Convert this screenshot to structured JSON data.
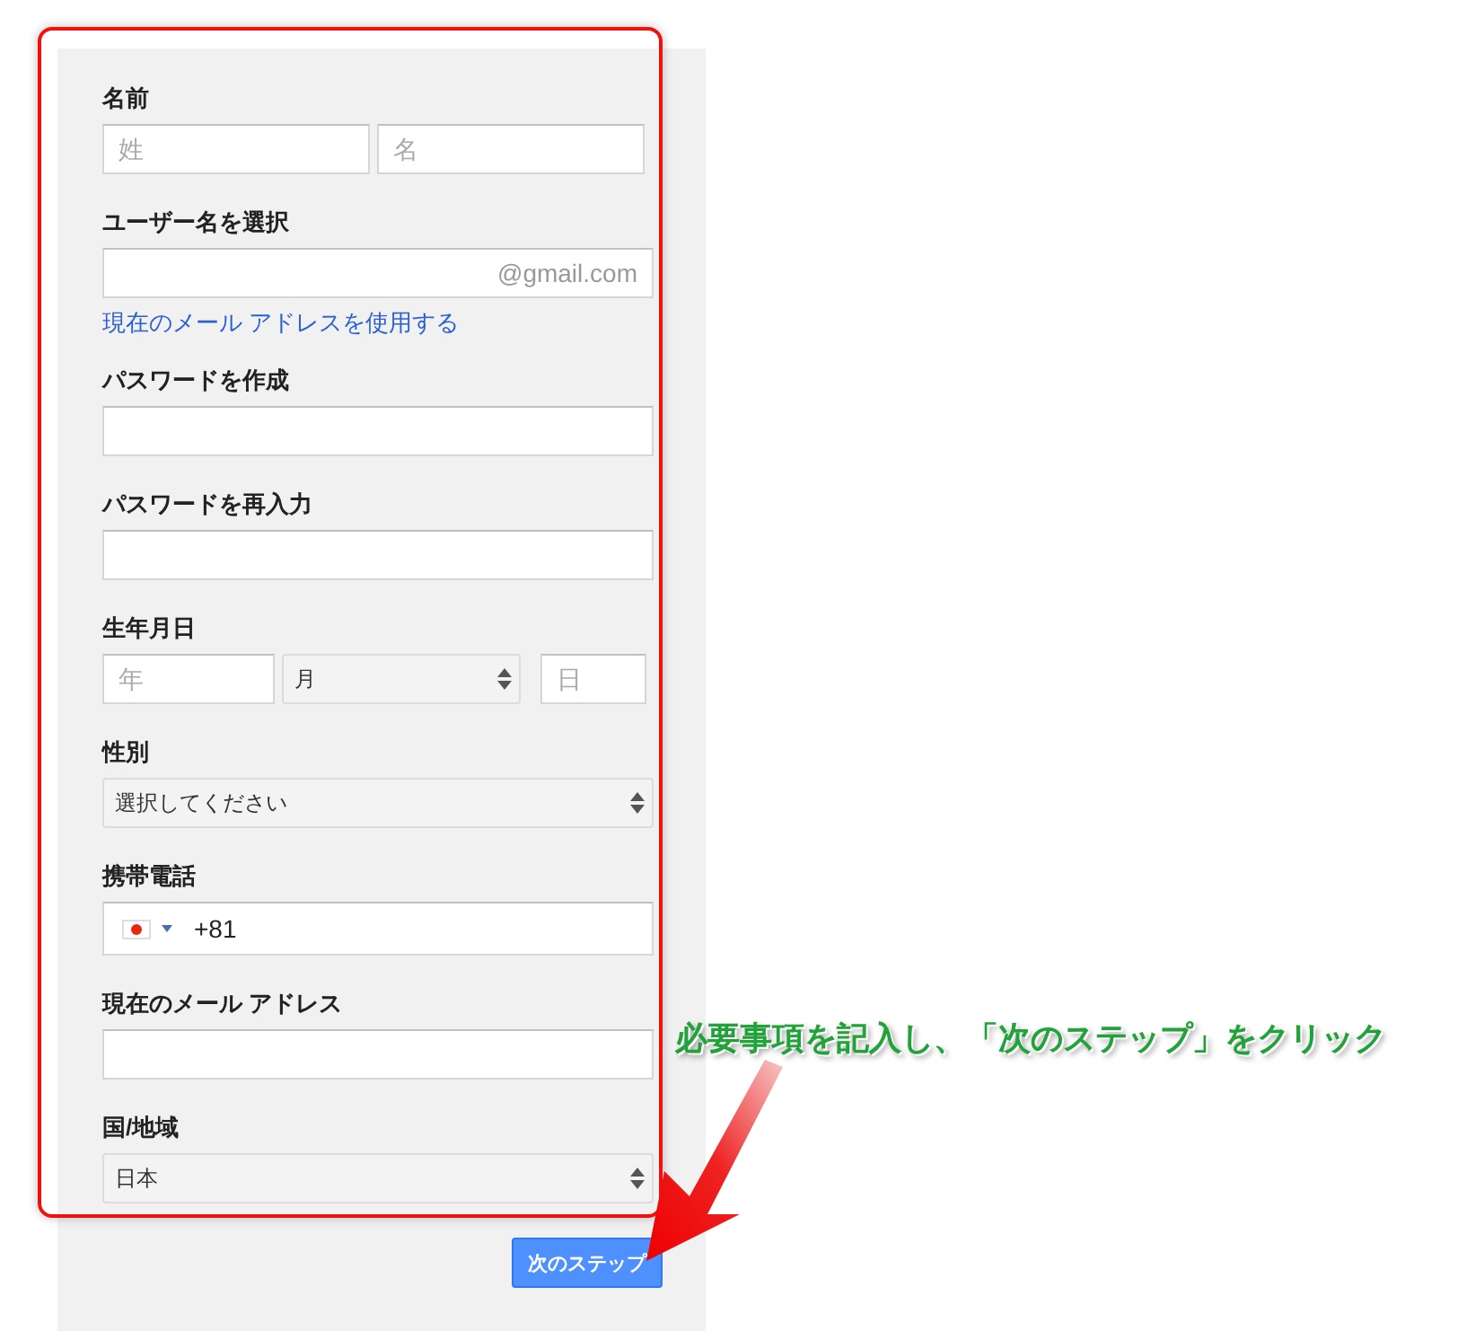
{
  "form": {
    "sections": [
      {
        "kind": "name",
        "label": "名前",
        "parts": [
          {
            "placeholder": "姓"
          },
          {
            "placeholder": "名"
          }
        ]
      },
      {
        "kind": "username",
        "label": "ユーザー名を選択",
        "suffix": "@gmail.com",
        "link": "現在のメール アドレスを使用する"
      },
      {
        "kind": "text",
        "label": "パスワードを作成"
      },
      {
        "kind": "text",
        "label": "パスワードを再入力"
      },
      {
        "kind": "date",
        "label": "生年月日",
        "year": {
          "placeholder": "年"
        },
        "month": "月",
        "day": {
          "placeholder": "日"
        }
      },
      {
        "kind": "select",
        "label": "性別",
        "value": "選択してください"
      },
      {
        "kind": "phone",
        "label": "携帯電話",
        "value": "+81"
      },
      {
        "kind": "text",
        "label": "現在のメール アドレス"
      },
      {
        "kind": "select",
        "label": "国/地域",
        "value": "日本"
      }
    ],
    "next_button": "次のステップ"
  },
  "annotation": {
    "text": "必要事項を記入し、「次のステップ」をクリック"
  }
}
